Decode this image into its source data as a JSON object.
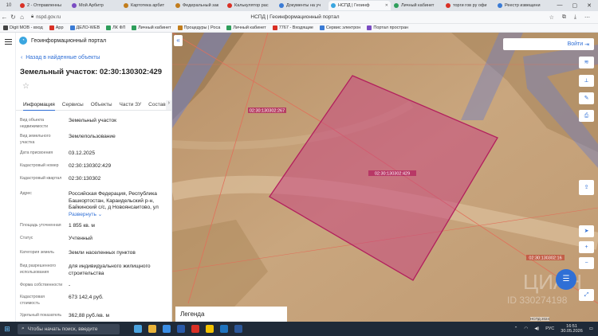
{
  "browser": {
    "tab_count": "10",
    "tabs": [
      {
        "label": "2 - Отправленны",
        "color": "#d93025"
      },
      {
        "label": "Мой Арбитр",
        "color": "#7a4cc2"
      },
      {
        "label": "Картотека арбит",
        "color": "#c27d1c"
      },
      {
        "label": "Федеральный зак",
        "color": "#c27d1c"
      },
      {
        "label": "Калькулятор рас",
        "color": "#d93025"
      },
      {
        "label": "Документы на уч",
        "color": "#3a7bd5"
      },
      {
        "label": "НСПД | Геоинф",
        "color": "#3aa6e0",
        "active": true
      },
      {
        "label": "Личный кабинет",
        "color": "#2e9e5b"
      },
      {
        "label": "торги гов ру офи",
        "color": "#d93025"
      },
      {
        "label": "Реестр извещени",
        "color": "#3a7bd5"
      }
    ],
    "url": "nspd.gov.ru",
    "page_title": "НСПД | Геоинформационный портал",
    "bookmarks": [
      {
        "label": "Digit МОВ - вход",
        "color": "#444"
      },
      {
        "label": "App",
        "color": "#d93025"
      },
      {
        "label": "ДЕЛО-WEB",
        "color": "#3a7bd5"
      },
      {
        "label": "ЛК ФЛ",
        "color": "#2e9e5b"
      },
      {
        "label": "Личный кабинет",
        "color": "#2e9e5b"
      },
      {
        "label": "Процедуры | Роса",
        "color": "#c27d1c"
      },
      {
        "label": "Личный кабинет",
        "color": "#2e9e5b"
      },
      {
        "label": "7767 - Входящие",
        "color": "#d93025"
      },
      {
        "label": "Сервис электрон",
        "color": "#3a7bd5"
      },
      {
        "label": "Портал простран",
        "color": "#7a4cc2"
      }
    ]
  },
  "portal": {
    "name": "Геоинформационный портал",
    "back_link": "Назад в найденные объекты",
    "title": "Земельный участок: 02:30:130302:429",
    "tabs": [
      "Информация",
      "Сервисы",
      "Объекты",
      "Части ЗУ",
      "Состав"
    ],
    "active_tab": "Информация"
  },
  "info": [
    {
      "label": "Вид объекта недвижимости",
      "value": "Земельный участок"
    },
    {
      "label": "Вид земельного участка",
      "value": "Землепользование"
    },
    {
      "label": "Дата присвоения",
      "value": "03.12.2025"
    },
    {
      "label": "Кадастровый номер",
      "value": "02:30:130302:429"
    },
    {
      "label": "Кадастровый квартал",
      "value": "02:30:130302"
    },
    {
      "label": "Адрес",
      "value": "Российская Федерация, Республика Башкортостан, Караидельский р-н, Байкинский с/с, д Новоянсаитово, ул",
      "link": "Развернуть"
    },
    {
      "label": "Площадь уточненная",
      "value": "1 855 кв. м"
    },
    {
      "label": "Статус",
      "value": "Учтенный"
    },
    {
      "label": "Категория земель",
      "value": "Земли населенных пунктов"
    },
    {
      "label": "Вид разрешенного использования",
      "value": "для индивидуального жилищного строительства"
    },
    {
      "label": "Форма собственности",
      "value": "-"
    },
    {
      "label": "Кадастровая стоимость",
      "value": "673 142,4 руб."
    },
    {
      "label": "Удельный показатель",
      "value": "362,88 руб./кв. м"
    }
  ],
  "map": {
    "login_label": "Войти",
    "parcel_label": "02:30:130302:429",
    "label_top": "02:30:130302:267",
    "label_right": "02:30:130302:16",
    "legend_label": "Легенда",
    "copyright": "НСПД 2024",
    "watermark": "ЦИАН",
    "watermark_id": "ID 330274198",
    "tools": [
      "layers-icon",
      "ruler-icon",
      "print-icon",
      "share-icon",
      "locate-icon",
      "zoom-in-icon",
      "zoom-out-icon"
    ]
  },
  "taskbar": {
    "search_placeholder": "Чтобы начать поиск, введите",
    "language": "РУС",
    "time": "16:51",
    "date": "30.05.2026"
  },
  "colors": {
    "accent": "#2f6fd6",
    "parcel_fill": "#c6477f",
    "parcel_stroke": "#b21f5d",
    "boundary": "#e0705a"
  }
}
